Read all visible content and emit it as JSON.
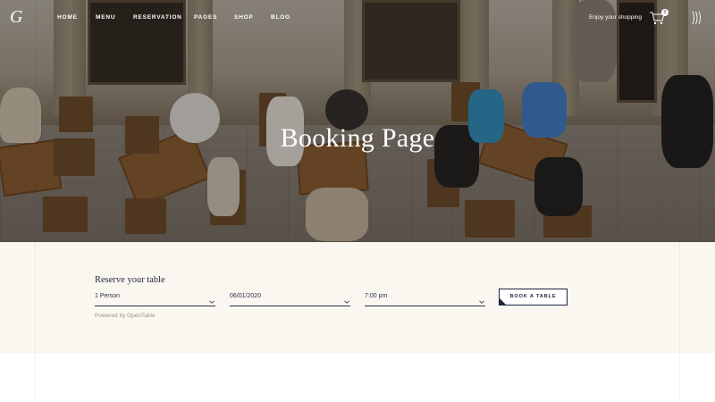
{
  "nav": {
    "logo": "G",
    "items": [
      {
        "label": "HOME"
      },
      {
        "label": "MENU"
      },
      {
        "label": "RESERVATION"
      },
      {
        "label": "PAGES"
      },
      {
        "label": "SHOP"
      },
      {
        "label": "BLOG"
      }
    ],
    "shop_text": "Enjoy your shopping",
    "cart_count": "0",
    "icons": [
      "cart-icon",
      "menu-icon"
    ]
  },
  "hero": {
    "title": "Booking Page"
  },
  "reservation": {
    "title": "Reserve your table",
    "party_size": "1 Person",
    "date": "06/01/2020",
    "time": "7:00 pm",
    "book_button": "BOOK A TABLE",
    "powered_by": "Powered by OpenTable"
  },
  "colors": {
    "accent": "#1c2540",
    "background": "#faf6f0"
  }
}
